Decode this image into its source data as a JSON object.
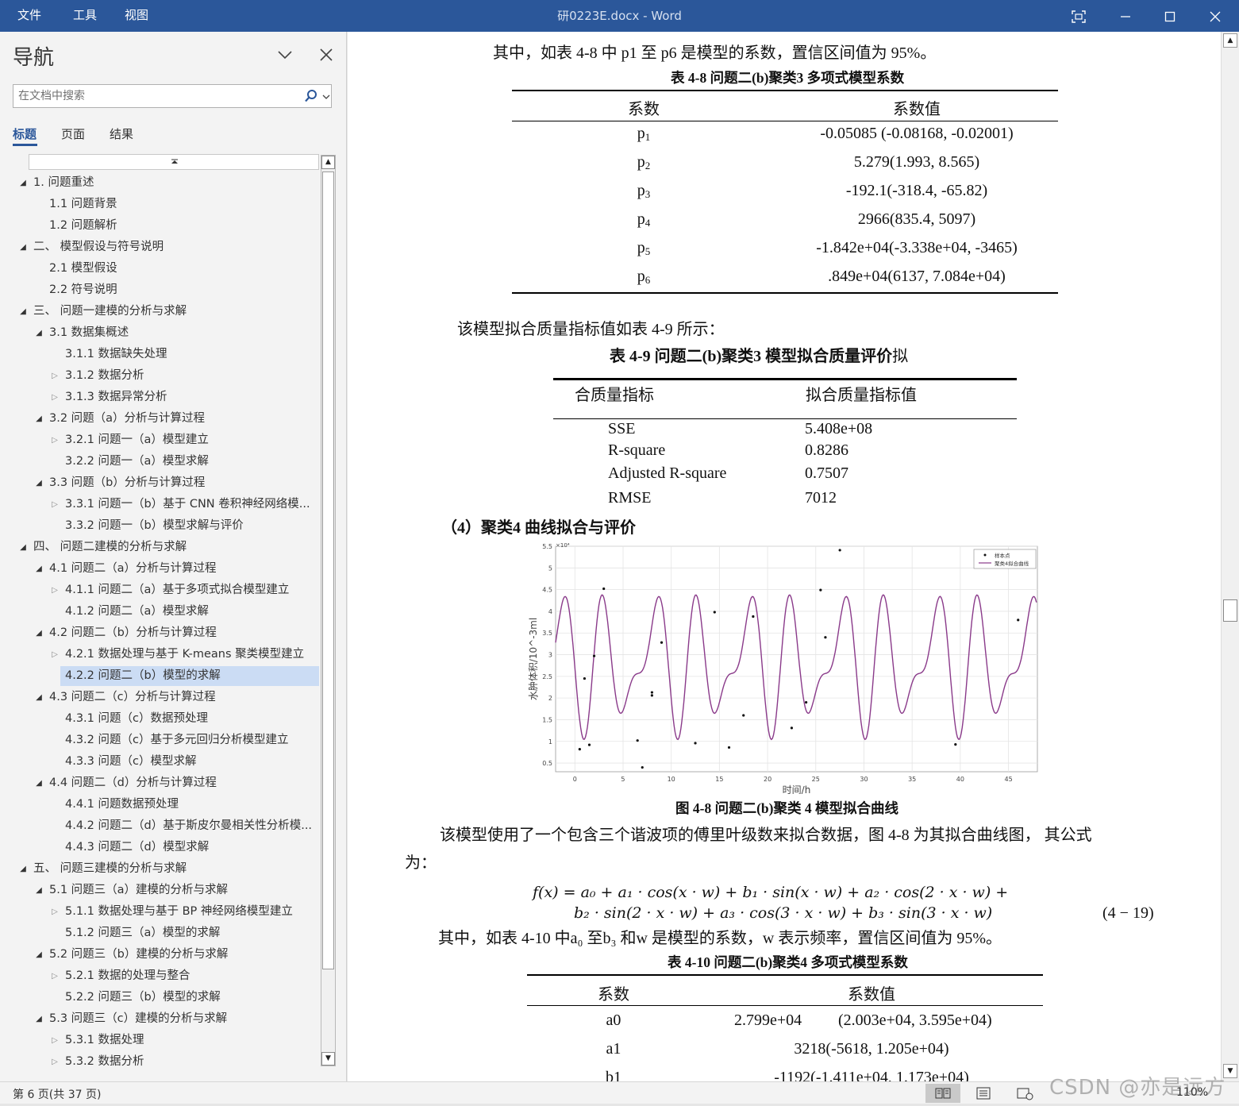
{
  "titlebar": {
    "menu": [
      "文件",
      "工具",
      "视图"
    ],
    "title": "研0223E.docx - Word"
  },
  "nav": {
    "title": "导航",
    "search_placeholder": "在文档中搜索",
    "tabs": [
      "标题",
      "页面",
      "结果"
    ],
    "items": [
      {
        "label": "1. 问题重述",
        "level": 1,
        "state": "open"
      },
      {
        "label": "1.1 问题背景",
        "level": 2,
        "state": "none"
      },
      {
        "label": "1.2 问题解析",
        "level": 2,
        "state": "none"
      },
      {
        "label": "二、 模型假设与符号说明",
        "level": 1,
        "state": "open"
      },
      {
        "label": "2.1 模型假设",
        "level": 2,
        "state": "none"
      },
      {
        "label": "2.2 符号说明",
        "level": 2,
        "state": "none"
      },
      {
        "label": "三、 问题一建模的分析与求解",
        "level": 1,
        "state": "open"
      },
      {
        "label": "3.1 数据集概述",
        "level": 2,
        "state": "open"
      },
      {
        "label": "3.1.1 数据缺失处理",
        "level": 3,
        "state": "none"
      },
      {
        "label": "3.1.2 数据分析",
        "level": 3,
        "state": "closed"
      },
      {
        "label": "3.1.3 数据异常分析",
        "level": 3,
        "state": "closed"
      },
      {
        "label": "3.2 问题（a）分析与计算过程",
        "level": 2,
        "state": "open"
      },
      {
        "label": "3.2.1 问题一（a）模型建立",
        "level": 3,
        "state": "closed"
      },
      {
        "label": "3.2.2 问题一（a）模型求解",
        "level": 3,
        "state": "none"
      },
      {
        "label": "3.3 问题（b）分析与计算过程",
        "level": 2,
        "state": "open"
      },
      {
        "label": "3.3.1 问题一（b）基于 CNN 卷积神经网络模...",
        "level": 3,
        "state": "closed"
      },
      {
        "label": "3.3.2 问题一（b）模型求解与评价",
        "level": 3,
        "state": "none"
      },
      {
        "label": "四、 问题二建模的分析与求解",
        "level": 1,
        "state": "open"
      },
      {
        "label": "4.1 问题二（a）分析与计算过程",
        "level": 2,
        "state": "open"
      },
      {
        "label": "4.1.1 问题二（a）基于多项式拟合模型建立",
        "level": 3,
        "state": "closed"
      },
      {
        "label": "4.1.2 问题二（a）模型求解",
        "level": 3,
        "state": "none"
      },
      {
        "label": "4.2 问题二（b）分析与计算过程",
        "level": 2,
        "state": "open"
      },
      {
        "label": "4.2.1 数据处理与基于 K-means 聚类模型建立",
        "level": 3,
        "state": "closed"
      },
      {
        "label": "4.2.2 问题二（b）模型的求解",
        "level": 3,
        "state": "closed",
        "selected": true
      },
      {
        "label": "4.3 问题二（c）分析与计算过程",
        "level": 2,
        "state": "open"
      },
      {
        "label": "4.3.1 问题（c）数据预处理",
        "level": 3,
        "state": "none"
      },
      {
        "label": "4.3.2 问题（c）基于多元回归分析模型建立",
        "level": 3,
        "state": "none"
      },
      {
        "label": "4.3.3 问题（c）模型求解",
        "level": 3,
        "state": "none"
      },
      {
        "label": "4.4 问题二（d）分析与计算过程",
        "level": 2,
        "state": "open"
      },
      {
        "label": "4.4.1 问题数据预处理",
        "level": 3,
        "state": "none"
      },
      {
        "label": "4.4.2 问题二（d）基于斯皮尔曼相关性分析模...",
        "level": 3,
        "state": "none"
      },
      {
        "label": "4.4.3 问题二（d）模型求解",
        "level": 3,
        "state": "none"
      },
      {
        "label": "五、 问题三建模的分析与求解",
        "level": 1,
        "state": "open"
      },
      {
        "label": "5.1 问题三（a）建模的分析与求解",
        "level": 2,
        "state": "open"
      },
      {
        "label": "5.1.1 数据处理与基于 BP 神经网络模型建立",
        "level": 3,
        "state": "closed"
      },
      {
        "label": "5.1.2 问题三（a）模型的求解",
        "level": 3,
        "state": "none"
      },
      {
        "label": "5.2 问题三（b）建模的分析与求解",
        "level": 2,
        "state": "open"
      },
      {
        "label": "5.2.1 数据的处理与整合",
        "level": 3,
        "state": "closed"
      },
      {
        "label": "5.2.2 问题三（b）模型的求解",
        "level": 3,
        "state": "none"
      },
      {
        "label": "5.3 问题三（c）建模的分析与求解",
        "level": 2,
        "state": "open"
      },
      {
        "label": "5.3.1 数据处理",
        "level": 3,
        "state": "closed"
      },
      {
        "label": "5.3.2 数据分析",
        "level": 3,
        "state": "closed"
      }
    ]
  },
  "doc": {
    "p1": "其中，如表 4-8 中 p1 至 p6 是模型的系数，置信区间值为 95%。",
    "t48_caption": "表 4-8  问题二(b)聚类3 多项式模型系数",
    "t48_headers": [
      "系数",
      "系数值"
    ],
    "t48_rows": [
      {
        "name": "p",
        "sub": "1",
        "value": "-0.05085 (-0.08168, -0.02001)"
      },
      {
        "name": "p",
        "sub": "2",
        "value": "5.279(1.993, 8.565)"
      },
      {
        "name": "p",
        "sub": "3",
        "value": "-192.1(-318.4, -65.82)"
      },
      {
        "name": "p",
        "sub": "4",
        "value": "2966(835.4, 5097)"
      },
      {
        "name": "p",
        "sub": "5",
        "value": "-1.842e+04(-3.338e+04, -3465)"
      },
      {
        "name": "p",
        "sub": "6",
        "value": ".849e+04(6137, 7.084e+04)"
      }
    ],
    "p2": "该模型拟合质量指标值如表 4-9 所示：",
    "t49_caption_bold": "表 4-9  问题二(b)聚类3 模型拟合质量评价",
    "t49_caption_tail": "拟",
    "t49_headers": [
      "合质量指标",
      "拟合质量指标值"
    ],
    "t49_rows": [
      {
        "name": "SSE",
        "value": "5.408e+08"
      },
      {
        "name": "R-square",
        "value": "0.8286"
      },
      {
        "name": "Adjusted R-square",
        "value": "0.7507"
      },
      {
        "name": "RMSE",
        "value": "7012"
      }
    ],
    "heading4": "（4）聚类4 曲线拟合与评价",
    "fig48_caption": "图 4-8  问题二(b)聚类 4 模型拟合曲线",
    "p3_line1": "该模型使用了一个包含三个谐波项的傅里叶级数来拟合数据，图 4-8 为其拟合曲线图，  其公式",
    "p3_line2": "为：",
    "formula_line1": "f(x) = a₀ + a₁ · cos(x · w) + b₁ · sin(x · w) + a₂ · cos(2 · x · w) +",
    "formula_line2": "b₂ · sin(2 · x · w) + a₃ · cos(3 · x · w) + b₃ · sin(3 · x · w)",
    "formula_no": "(4 − 19)",
    "p4": "其中，如表 4-10 中a₀ 至b₃ 和w 是模型的系数，w 表示频率，置信区间值为 95%。",
    "t410_caption": "表 4-10  问题二(b)聚类4 多项式模型系数",
    "t410_headers": [
      "系数",
      "系数值"
    ],
    "t410_rows": [
      {
        "name": "a0",
        "value": "2.799e+04",
        "ci": "(2.003e+04, 3.595e+04)"
      },
      {
        "name": "a1",
        "value": "3218(-5618, 1.205e+04)",
        "ci": ""
      },
      {
        "name": "b1",
        "value": "-1192(-1.411e+04, 1.173e+04)",
        "ci": ""
      }
    ]
  },
  "chart_data": {
    "type": "scatter",
    "xlabel": "时间/h",
    "ylabel": "水肿体积/10^-3ml",
    "y_exponent": "×10⁴",
    "xlim": [
      -2,
      48
    ],
    "ylim": [
      0.3,
      5.5
    ],
    "xticks": [
      0,
      5,
      10,
      15,
      20,
      25,
      30,
      35,
      40,
      45
    ],
    "yticks": [
      0.5,
      1,
      1.5,
      2,
      2.5,
      3,
      3.5,
      4,
      4.5,
      5,
      5.5
    ],
    "grid": true,
    "legend_position": "top-right",
    "series": [
      {
        "name": "样本点",
        "kind": "points",
        "x": [
          0.5,
          1.0,
          1.5,
          2.0,
          3.0,
          6.5,
          7.0,
          8.0,
          8.0,
          9.0,
          12.5,
          14.5,
          16.0,
          17.5,
          18.5,
          22.5,
          24.0,
          25.5,
          26.0,
          27.5,
          39.5,
          46.0
        ],
        "y": [
          0.82,
          2.45,
          0.92,
          2.97,
          4.52,
          1.02,
          0.4,
          2.13,
          2.06,
          3.28,
          0.96,
          3.98,
          0.86,
          1.6,
          3.88,
          1.31,
          1.9,
          4.49,
          3.4,
          5.41,
          0.93,
          3.8
        ]
      },
      {
        "name": "聚类4拟合曲线",
        "kind": "curve",
        "formula": "a0 + a1*cos(x*w) + b1*sin(x*w) + a2*cos(2*x*w) + b2*sin(2*x*w) + a3*cos(3*x*w) + b3*sin(3*x*w)"
      }
    ]
  },
  "status": {
    "page_info": "第 6 页(共 37 页)",
    "zoom": "110%",
    "watermark": "CSDN @亦是远方"
  }
}
